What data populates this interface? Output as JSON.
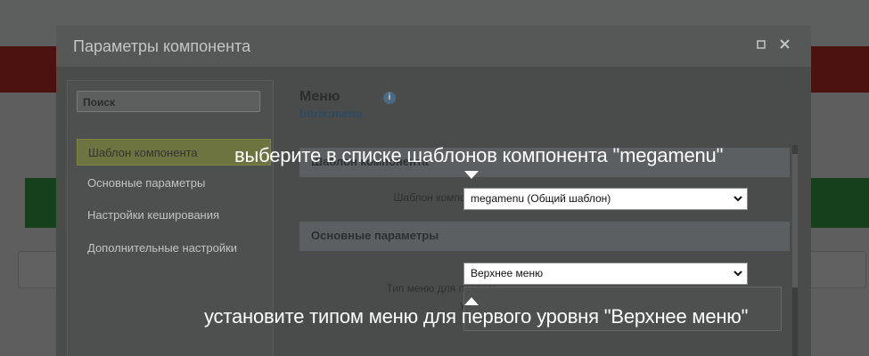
{
  "dialog": {
    "title": "Параметры компонента",
    "maximize_icon": "maximize-icon",
    "close_icon": "close-icon"
  },
  "sidebar": {
    "search_placeholder": "Поиск",
    "items": [
      {
        "label": "Шаблон компонента",
        "active": true
      },
      {
        "label": "Основные параметры",
        "active": false
      },
      {
        "label": "Настройки кеширования",
        "active": false
      },
      {
        "label": "Дополнительные настройки",
        "active": false
      }
    ]
  },
  "component": {
    "name": "Меню",
    "code": "bitrix:menu",
    "info_icon": "i"
  },
  "sections": {
    "template_section": "Шаблон компонента",
    "main_section": "Основные параметры"
  },
  "fields": {
    "template_label": "Шаблон компонента:",
    "template_value": "megamenu (Общий шаблон)",
    "menu_type_label_1": "Тип меню для первого",
    "menu_type_label_2": "уровня:",
    "menu_type_value": "Верхнее меню"
  },
  "callouts": {
    "top": "выберите в списке шаблонов компонента \"megamenu\"",
    "bottom": "установите типом меню для первого уровня \"Верхнее меню\""
  },
  "colors": {
    "overlay_text": "#ffffff",
    "active_nav": "#6d7440",
    "link_blue": "#2d4b63"
  }
}
